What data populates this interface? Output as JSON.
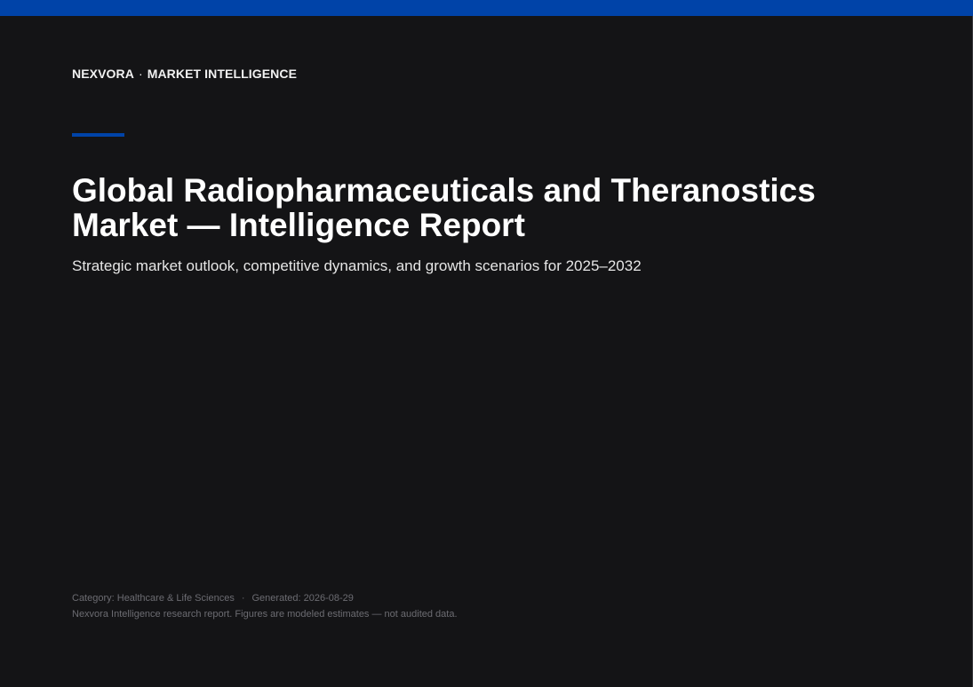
{
  "colors": {
    "accent": "#0043a8",
    "background": "#141416"
  },
  "header": {
    "brand": "NEXVORA",
    "separator": "·",
    "section": "MARKET INTELLIGENCE"
  },
  "report": {
    "title": "Global Radiopharmaceuticals and Theranostics Market — Intelligence Report",
    "subtitle": "Strategic market outlook, competitive dynamics, and growth scenarios for 2025–2032"
  },
  "footer": {
    "category": "Category: Healthcare & Life Sciences",
    "separator": "·",
    "generated": "Generated: 2026-08-29",
    "disclaimer": "Nexvora Intelligence research report. Figures are modeled estimates — not audited data."
  }
}
